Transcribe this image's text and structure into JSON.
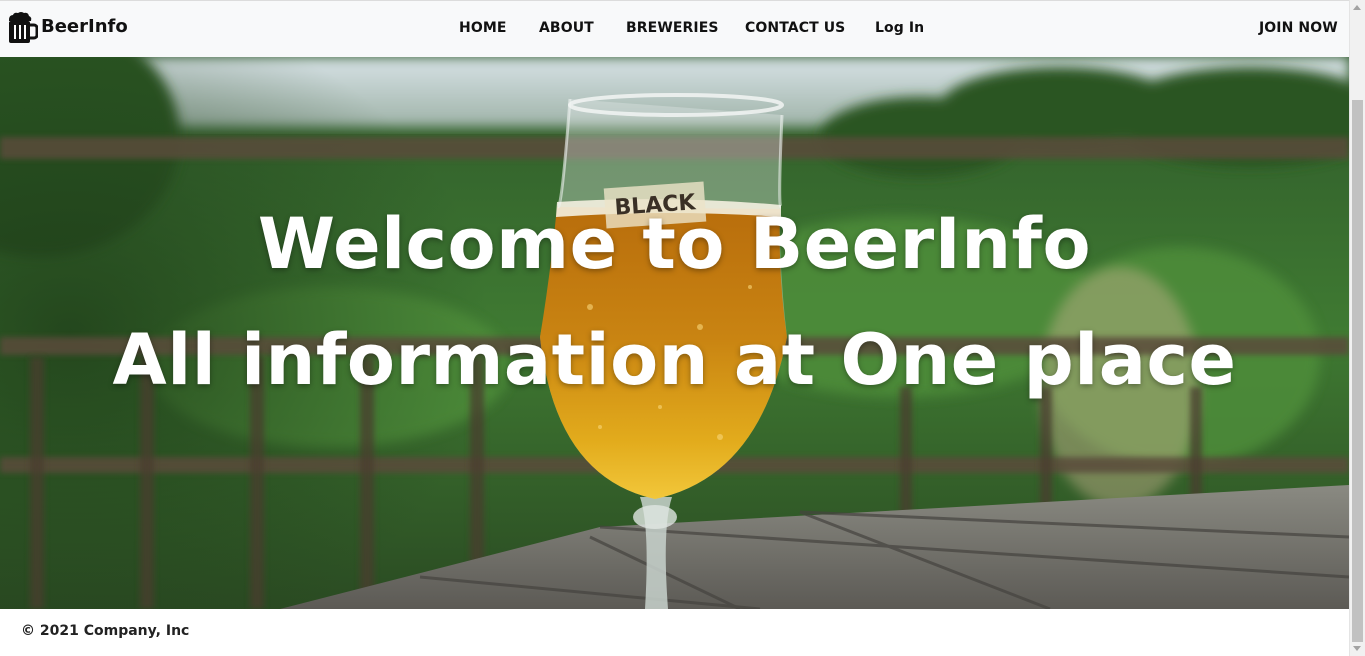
{
  "brand": {
    "name": "BeerInfo",
    "icon": "beer-mug-icon"
  },
  "nav": {
    "items": [
      {
        "label": "HOME"
      },
      {
        "label": "ABOUT"
      },
      {
        "label": "BREWERIES"
      },
      {
        "label": "CONTACT US"
      },
      {
        "label": "Log In"
      }
    ],
    "join_label": "JOIN NOW"
  },
  "hero": {
    "line1": "Welcome to BeerInfo",
    "line2": "All information at One place",
    "glass_logo_text": "BLACK"
  },
  "footer": {
    "text": "© 2021 Company, Inc"
  },
  "colors": {
    "navbar_bg": "#f8f9fa",
    "hero_text": "#ffffff",
    "beer_amber": "#d39a14"
  }
}
